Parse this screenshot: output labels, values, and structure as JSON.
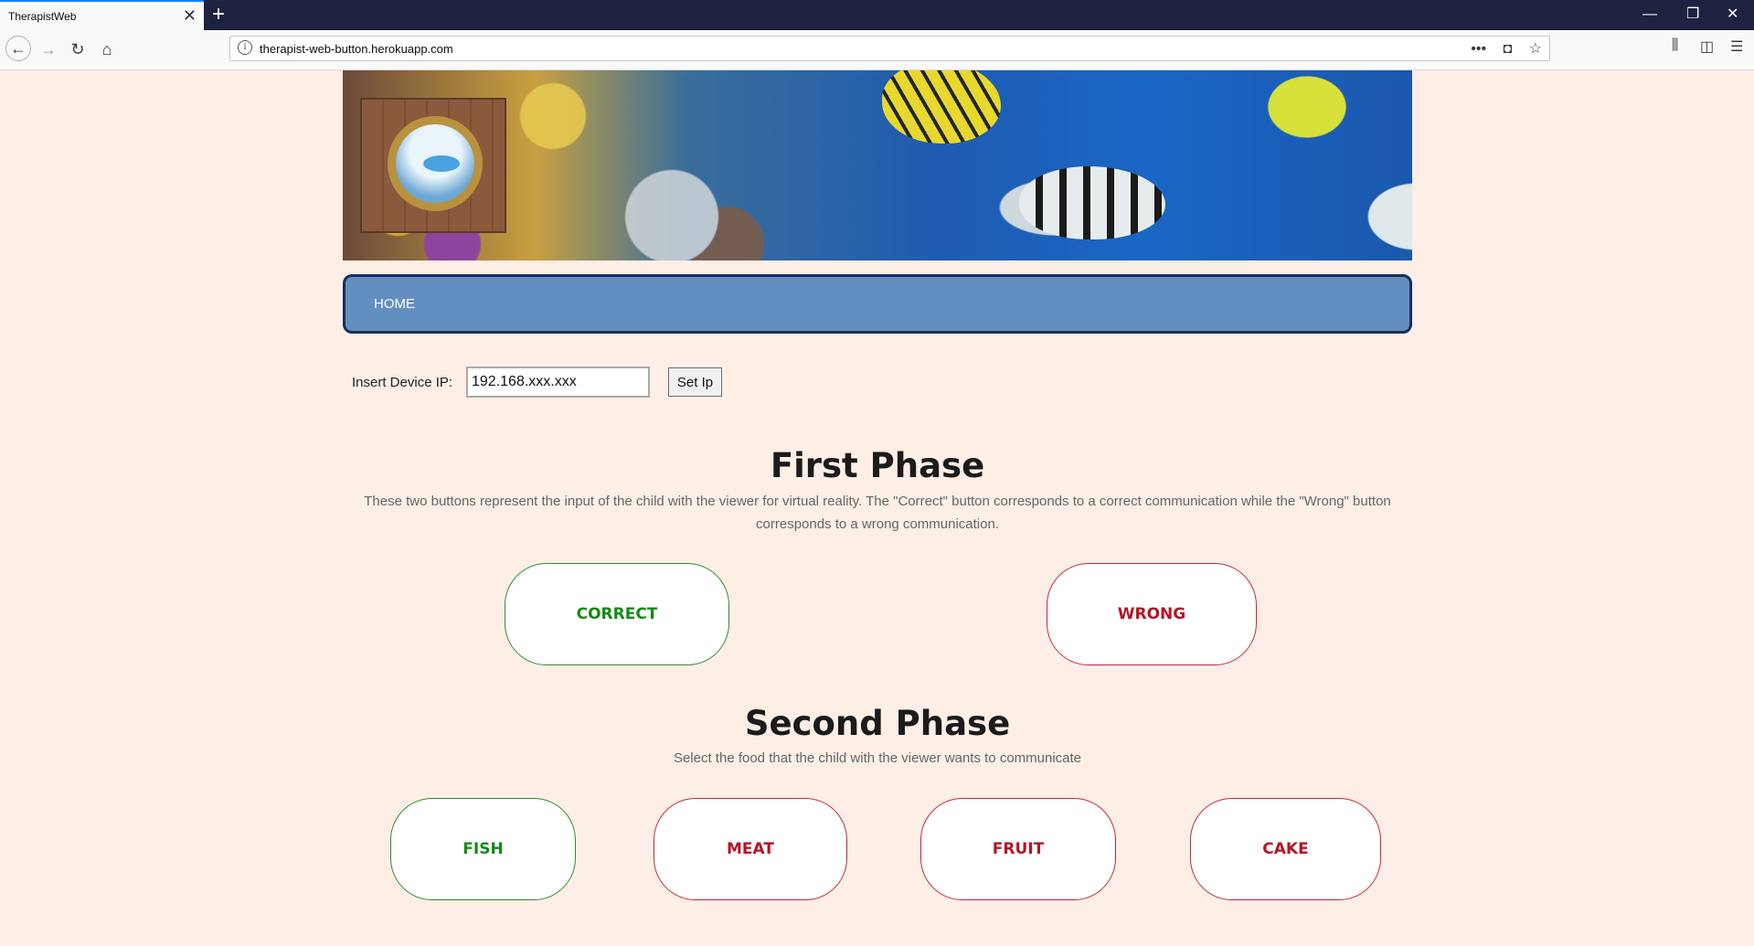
{
  "browser": {
    "tab_title": "TherapistWeb",
    "url": "therapist-web-button.herokuapp.com"
  },
  "nav": {
    "home_label": "HOME"
  },
  "ip_form": {
    "label": "Insert Device IP:",
    "value": "192.168.xxx.xxx",
    "button_label": "Set Ip"
  },
  "first_phase": {
    "title": "First Phase",
    "description": "These two buttons represent the input of the child with the viewer for virtual reality. The \"Correct\" button corresponds to a correct communication while the \"Wrong\" button corresponds to a wrong communication.",
    "correct_label": "CORRECT",
    "wrong_label": "WRONG"
  },
  "second_phase": {
    "title": "Second Phase",
    "description": "Select the food that the child with the viewer wants to communicate",
    "options": [
      "FISH",
      "MEAT",
      "FRUIT",
      "CAKE"
    ]
  },
  "colors": {
    "page_bg": "#fdeee6",
    "menu_bg": "#638fc0",
    "menu_border": "#172f5c",
    "correct": "#148a14",
    "wrong": "#b31525"
  }
}
